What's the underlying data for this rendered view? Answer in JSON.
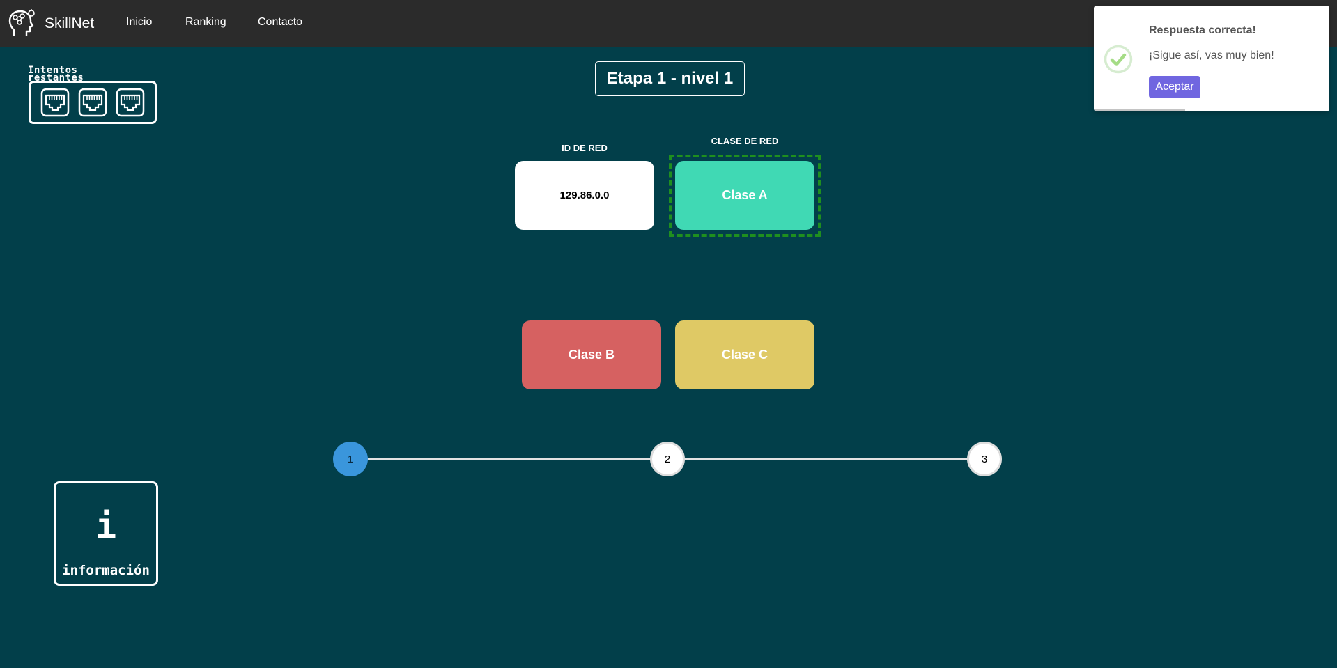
{
  "navbar": {
    "brand": "SkillNet",
    "links": [
      "Inicio",
      "Ranking",
      "Contacto"
    ]
  },
  "attempts": {
    "label": "Intentos restantes",
    "remaining": 3,
    "icon": "ethernet-port-icon"
  },
  "stage": {
    "title": "Etapa 1 - nivel 1"
  },
  "question": {
    "id_label": "ID DE RED",
    "id_value": "129.86.0.0",
    "class_label": "CLASE DE RED",
    "answer": "Clase A"
  },
  "options": [
    {
      "label": "Clase B",
      "color": "#d66161"
    },
    {
      "label": "Clase C",
      "color": "#dfc965"
    }
  ],
  "answer_color": "#40d9b4",
  "progress": {
    "steps": [
      "1",
      "2",
      "3"
    ],
    "current": 1
  },
  "info": {
    "icon_text": "i",
    "label": "información"
  },
  "toast": {
    "title": "Respuesta correcta!",
    "text": "¡Sigue así, vas muy bien!",
    "button": "Aceptar",
    "icon": "checkmark-icon"
  }
}
